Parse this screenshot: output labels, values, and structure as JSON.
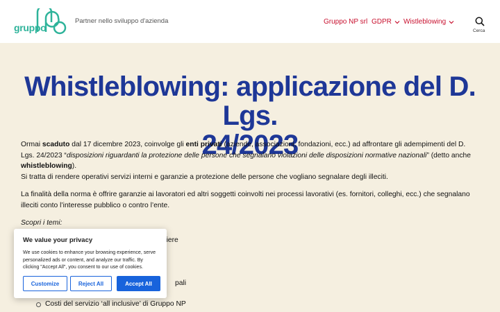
{
  "header": {
    "logo_text": "gruppo",
    "tagline": "Partner nello sviluppo d'azienda",
    "nav": [
      {
        "label": "Gruppo NP srl",
        "has_dropdown": false
      },
      {
        "label": "GDPR",
        "has_dropdown": true
      },
      {
        "label": "Wistleblowing",
        "has_dropdown": true
      }
    ],
    "search_label": "Cerca"
  },
  "article": {
    "title_line1": "Whistleblowing: applicazione del D. Lgs.",
    "title_line2": "24/2023",
    "p1": {
      "t1": "Ormai ",
      "b1": "scaduto",
      "t2": " dal 17 dicembre 2023, coinvolge gli ",
      "b2": "enti privati",
      "t3": " (aziende, associazioni, fondazioni, ecc.) ad affrontare gli adempimenti del D. Lgs. 24/2023 “",
      "i1": "disposizioni riguardanti la protezione delle persone che segnalano violazioni delle disposizioni normative nazionali",
      "t4": "” (detto anche ",
      "b3": "whistleblowing",
      "t5": ").",
      "t6": "Si tratta di rendere operativi servizi interni e garanzie a protezione delle persone che vogliano segnalare degli illeciti."
    },
    "p2": "La finalità della norma è offrire garanzie ai lavoratori ed altri soggetti coinvolti nei processi lavorativi (es. fornitori, colleghi, ecc.) che segnalano illeciti conto l’interesse pubblico o contro l’ente.",
    "topics_heading": "Scopri i temi:",
    "topics": [
      "Chi sono i soggetti obbligati ad adempiere",
      "",
      "",
      "",
      "pali",
      "",
      "Costi del servizio ‘all inclusive’ di Gruppo NP"
    ]
  },
  "cookie_banner": {
    "title": "We value your privacy",
    "text": "We use cookies to enhance your browsing experience, serve personalized ads or content, and analyze our traffic. By clicking \"Accept All\", you consent to our use of cookies.",
    "customize": "Customize",
    "reject": "Reject All",
    "accept": "Accept All"
  },
  "colors": {
    "brand_green": "#2eb39a",
    "nav_red": "#c8102e",
    "title_blue": "#1e3797",
    "page_bg": "#f5efe0",
    "cookie_blue": "#1863dc"
  }
}
